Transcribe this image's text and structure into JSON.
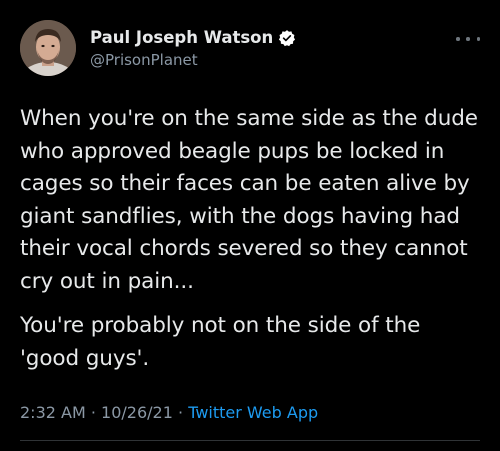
{
  "user": {
    "display_name": "Paul Joseph Watson",
    "handle": "@PrisonPlanet",
    "verified": true
  },
  "tweet": {
    "paragraphs": [
      "When you're on the same side as the dude who approved beagle pups be locked in cages so their faces can be eaten alive by giant sandflies, with the dogs having had their vocal chords severed so they cannot cry out in pain...",
      "You're probably not on the side of the 'good guys'."
    ],
    "time": "2:32 AM",
    "separator": "·",
    "date": "10/26/21",
    "source": "Twitter Web App"
  },
  "icons": {
    "verified": "verified-badge-icon",
    "more": "more-options-icon"
  },
  "colors": {
    "background": "#000000",
    "text": "#e7e9ea",
    "secondary": "#8b98a5",
    "link": "#1d9bf0"
  }
}
